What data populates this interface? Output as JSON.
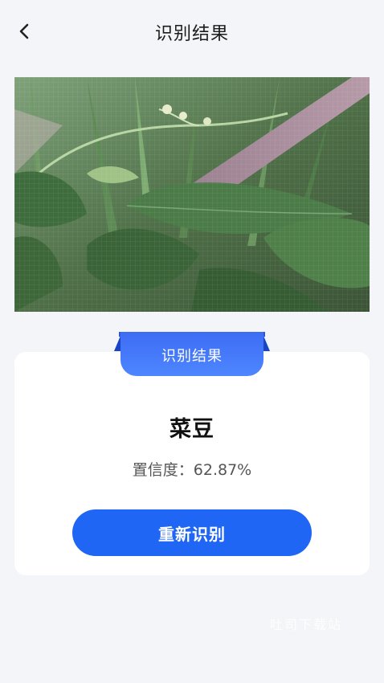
{
  "header": {
    "title": "识别结果",
    "back_icon": "chevron-left-icon"
  },
  "photo": {
    "description_icon": "plant-photo"
  },
  "result": {
    "ribbon_label": "识别结果",
    "name": "菜豆",
    "confidence_label": "置信度：",
    "confidence_value": "62.87%",
    "confidence_text": "置信度：62.87%"
  },
  "actions": {
    "retry_label": "重新识别"
  },
  "watermark": {
    "text": "吐司下载站"
  },
  "colors": {
    "primary": "#1f66f4",
    "ribbon": "#4e86ff",
    "background": "#f4f5f8",
    "card": "#ffffff"
  }
}
